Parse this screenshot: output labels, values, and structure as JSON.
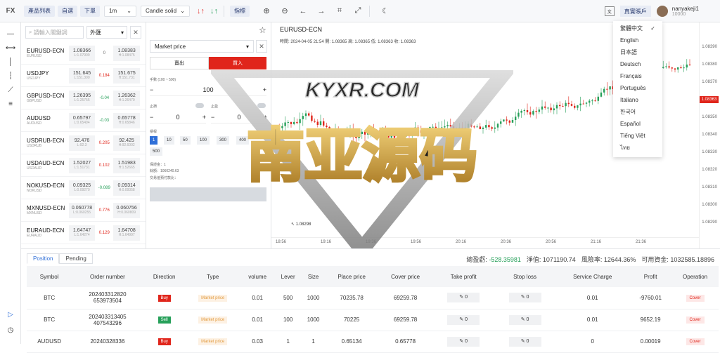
{
  "topbar": {
    "logo": "FX",
    "product_list": "產品列表",
    "self_select": "自選",
    "place_order": "下單",
    "interval": "1m",
    "candle_type": "Candle solid",
    "indicator": "指標",
    "real_account": "真實賬戶",
    "username": "nanyakeji1",
    "user_id": "10000"
  },
  "language_menu": {
    "items": [
      "繁體中文",
      "English",
      "日本語",
      "Deutsch",
      "Français",
      "Português",
      "Italiano",
      "한국어",
      "Español",
      "Tiếng Việt",
      "ไทย"
    ],
    "selected_mark": "✓"
  },
  "watchlist": {
    "search_placeholder": "請輸入關鍵詞",
    "category": "外匯",
    "rows": [
      {
        "symbol": "EURUSD-ECN",
        "desc": "EURUSD",
        "bid": "1.08366",
        "bid_low": "L:1.07909",
        "change": "0",
        "ask": "1.08383",
        "ask_high": "H:1.08475",
        "color": "#666666"
      },
      {
        "symbol": "USDJPY",
        "desc": "USDJPY",
        "bid": "151.645",
        "bid_low": "L:151.300",
        "change": "0.184",
        "ask": "151.675",
        "ask_high": "H:151.731",
        "color": "#e0251b"
      },
      {
        "symbol": "GBPUSD-ECN",
        "desc": "GBPUSD",
        "bid": "1.26395",
        "bid_low": "L:1.25755",
        "change": "-0.04",
        "ask": "1.26362",
        "ask_high": "H:1.26470",
        "color": "#27a05a"
      },
      {
        "symbol": "AUDUSD",
        "desc": "AUDUSD",
        "bid": "0.65797",
        "bid_low": "L:0.65494",
        "change": "-0.03",
        "ask": "0.65778",
        "ask_high": "H:0.65846",
        "color": "#27a05a"
      },
      {
        "symbol": "USDRUB-ECN",
        "desc": "USDRUB",
        "bid": "92.476",
        "bid_low": "L:92.3",
        "change": "0.205",
        "ask": "92.425",
        "ask_high": "H:92.6002",
        "color": "#e0251b"
      },
      {
        "symbol": "USDAUD-ECN",
        "desc": "USDAUD",
        "bid": "1.52027",
        "bid_low": "L:1.51731",
        "change": "0.102",
        "ask": "1.51983",
        "ask_high": "H:1.52665",
        "color": "#e0251b"
      },
      {
        "symbol": "NOKUSD-ECN",
        "desc": "NOKUSD",
        "bid": "0.09325",
        "bid_low": "L:0.09270",
        "change": "-0.089",
        "ask": "0.09314",
        "ask_high": "H:0.09358",
        "color": "#27a05a"
      },
      {
        "symbol": "MXNUSD-ECN",
        "desc": "MXNUSD",
        "bid": "0.060778",
        "bid_low": "L:0.060255",
        "change": "0.776",
        "ask": "0.060756",
        "ask_high": "H:0.060809",
        "color": "#e0251b"
      },
      {
        "symbol": "EURAUD-ECN",
        "desc": "EURAUD",
        "bid": "1.64747",
        "bid_low": "L:1.64274",
        "change": "0.129",
        "ask": "1.64708",
        "ask_high": "H:1.64997",
        "color": "#e0251b"
      }
    ]
  },
  "order_panel": {
    "order_type": "Market price",
    "sell_label": "賣出",
    "buy_label": "買入",
    "lots_label": "手數 (100 ~ 500)",
    "lots_value": "100",
    "stop_loss_label": "止損",
    "take_profit_label": "止盈",
    "stop_loss_value": "0",
    "take_profit_value": "0",
    "leverage_label": "槓桿",
    "leverage_options": [
      "1",
      "10",
      "50",
      "100",
      "300",
      "400",
      "500"
    ],
    "info_line1": "保證金：1",
    "info_line2": "餘額：1060240.63",
    "info_line3": "交易值預付款比：",
    "minus": "−",
    "plus": "+"
  },
  "chart": {
    "symbol": "EURUSD-ECN",
    "info": "時間: 2024-04-05 21:54   開: 1.08365   高: 1.08365   低: 1.08363   收: 1.08363",
    "price_labels": [
      "1.08390",
      "1.08380",
      "1.08370",
      "1.08360",
      "1.08350",
      "1.08340",
      "1.08330",
      "1.08320",
      "1.08310",
      "1.08300",
      "1.08290"
    ],
    "current_price": "1.08363",
    "low_marker": "1.08298",
    "time_labels": [
      "18:56",
      "19:16",
      "19:36",
      "19:56",
      "20:16",
      "20:36",
      "20:56",
      "21:16",
      "21:36"
    ]
  },
  "watermark": {
    "line1": "KYXR.COM",
    "line2": "南亚源码"
  },
  "positions": {
    "tab_position": "Position",
    "tab_pending": "Pending",
    "summary": {
      "profit_label": "總盈虧:",
      "profit_value": "-528.35981",
      "equity_label": "淨值:",
      "equity_value": "1071190.74",
      "risk_label": "風險率:",
      "risk_value": "12644.36%",
      "available_label": "可用資金:",
      "available_value": "1032585.18896"
    },
    "headers": [
      "Symbol",
      "Order number",
      "Direction",
      "Type",
      "volume",
      "Lever",
      "Size",
      "Place price",
      "Cover price",
      "Take profit",
      "Stop loss",
      "Service Charge",
      "Profit",
      "Operation"
    ],
    "rows": [
      {
        "symbol": "BTC",
        "order1": "202403312820",
        "order2": "653973504",
        "direction": "Buy",
        "type": "Market price",
        "volume": "0.01",
        "lever": "500",
        "size": "1000",
        "place": "70235.78",
        "cover": "69259.78",
        "tp": "0",
        "sl": "0",
        "charge": "0.01",
        "profit": "-9760.01",
        "op": "Cover"
      },
      {
        "symbol": "BTC",
        "order1": "202403313405",
        "order2": "407543296",
        "direction": "Sell",
        "type": "Market price",
        "volume": "0.01",
        "lever": "100",
        "size": "1000",
        "place": "70225",
        "cover": "69259.78",
        "tp": "0",
        "sl": "0",
        "charge": "0.01",
        "profit": "9652.19",
        "op": "Cover"
      },
      {
        "symbol": "AUDUSD",
        "order1": "20240328336",
        "order2": "",
        "direction": "Buy",
        "type": "Market price",
        "volume": "0.03",
        "lever": "1",
        "size": "1",
        "place": "0.65134",
        "cover": "0.65778",
        "tp": "0",
        "sl": "0",
        "charge": "0",
        "profit": "0.00019",
        "op": "Cover"
      }
    ]
  },
  "colors": {
    "red": "#e0251b",
    "green": "#27a05a",
    "accent": "#2f6fd8"
  }
}
